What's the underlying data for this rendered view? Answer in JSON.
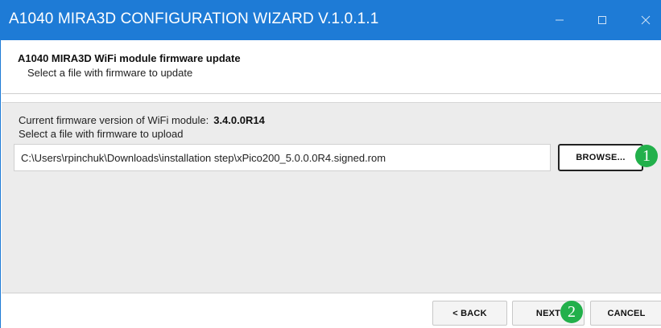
{
  "window": {
    "title": "A1040 MIRA3D CONFIGURATION WIZARD V.1.0.1.1",
    "controls": {
      "minimize_icon": "minimize-icon",
      "maximize_icon": "maximize-icon",
      "close_icon": "close-icon"
    },
    "accent_color": "#1e7bd6"
  },
  "header": {
    "title": "A1040 MIRA3D WiFi module firmware update",
    "subtitle": "Select a file with firmware to update"
  },
  "main": {
    "firmware_label": "Current firmware version of WiFi module:",
    "firmware_version": "3.4.0.0R14",
    "select_label": "Select a file with firmware to upload",
    "file_path": "C:\\Users\\rpinchuk\\Downloads\\installation step\\xPico200_5.0.0.0R4.signed.rom",
    "browse_label": "BROWSE..."
  },
  "annotations": {
    "step1": "1",
    "step2": "2",
    "badge_color": "#22b04b"
  },
  "footer": {
    "back_label": "< BACK",
    "next_label": "NEXT",
    "cancel_label": "CANCEL"
  }
}
